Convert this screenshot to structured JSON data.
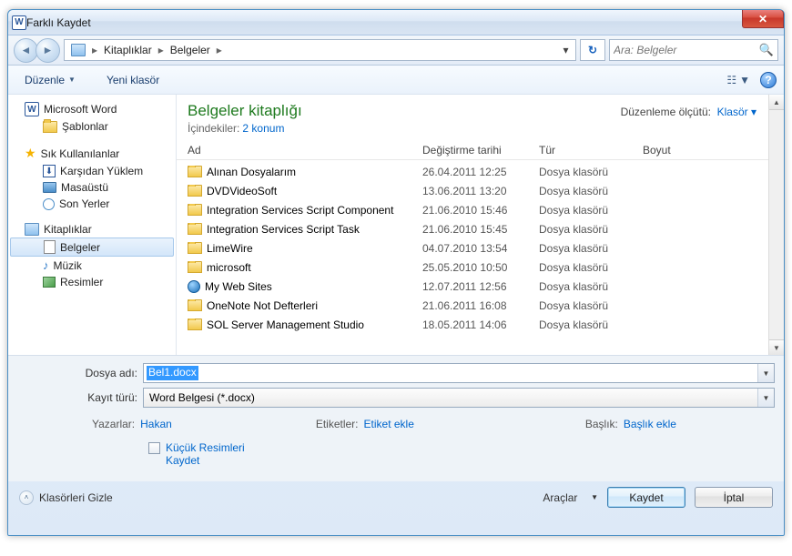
{
  "window": {
    "title": "Farklı Kaydet"
  },
  "nav": {
    "breadcrumb": [
      "Kitaplıklar",
      "Belgeler"
    ],
    "search_placeholder": "Ara: Belgeler"
  },
  "toolbar": {
    "organize": "Düzenle",
    "new_folder": "Yeni klasör"
  },
  "sidebar": {
    "ms_word": "Microsoft Word",
    "templates": "Şablonlar",
    "favorites": "Sık Kullanılanlar",
    "downloads": "Karşıdan Yüklem",
    "desktop": "Masaüstü",
    "recent": "Son Yerler",
    "libraries": "Kitaplıklar",
    "documents": "Belgeler",
    "music": "Müzik",
    "pictures": "Resimler"
  },
  "content": {
    "library_title": "Belgeler kitaplığı",
    "includes_label": "İçindekiler:",
    "includes_count": "2 konum",
    "arrange_label": "Düzenleme ölçütü:",
    "arrange_value": "Klasör",
    "columns": {
      "name": "Ad",
      "date": "Değiştirme tarihi",
      "type": "Tür",
      "size": "Boyut"
    },
    "type_folder": "Dosya klasörü",
    "files": [
      {
        "name": "Alınan Dosyalarım",
        "date": "26.04.2011 12:25",
        "kind": "folder"
      },
      {
        "name": "DVDVideoSoft",
        "date": "13.06.2011 13:20",
        "kind": "folder"
      },
      {
        "name": "Integration Services Script Component",
        "date": "21.06.2010 15:46",
        "kind": "folder"
      },
      {
        "name": "Integration Services Script Task",
        "date": "21.06.2010 15:45",
        "kind": "folder"
      },
      {
        "name": "LimeWire",
        "date": "04.07.2010 13:54",
        "kind": "folder"
      },
      {
        "name": "microsoft",
        "date": "25.05.2010 10:50",
        "kind": "folder"
      },
      {
        "name": "My Web Sites",
        "date": "12.07.2011 12:56",
        "kind": "web"
      },
      {
        "name": "OneNote Not Defterleri",
        "date": "21.06.2011 16:08",
        "kind": "folder"
      },
      {
        "name": "SOL Server Management Studio",
        "date": "18.05.2011 14:06",
        "kind": "folder"
      }
    ]
  },
  "form": {
    "filename_label": "Dosya adı:",
    "filename_value": "Bel1.docx",
    "filetype_label": "Kayıt türü:",
    "filetype_value": "Word Belgesi (*.docx)",
    "authors_label": "Yazarlar:",
    "authors_value": "Hakan",
    "tags_label": "Etiketler:",
    "tags_value": "Etiket ekle",
    "title_label": "Başlık:",
    "title_value": "Başlık ekle",
    "thumb_label": "Küçük Resimleri\nKaydet"
  },
  "footer": {
    "hide_folders": "Klasörleri Gizle",
    "tools": "Araçlar",
    "save": "Kaydet",
    "cancel": "İptal"
  }
}
